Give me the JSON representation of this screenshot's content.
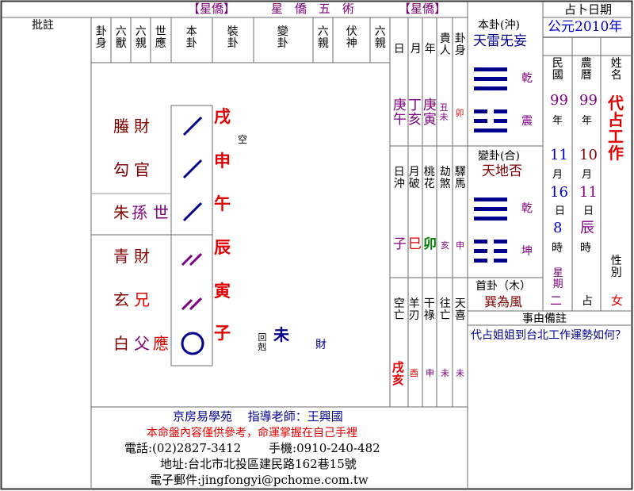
{
  "header": {
    "tag_left": "【星僑】",
    "title": "星　僑　五　術",
    "tag_right": "【星僑】",
    "pizhu": "批註"
  },
  "columns": {
    "guashen": "卦身",
    "liushou": "六獸",
    "liuqin": "六親",
    "shiying": "世應",
    "bengua": "本卦",
    "zhuanggua": "裝卦",
    "biangua": "變卦",
    "liuqin2": "六親",
    "fushen": "伏神",
    "liuqin3": "六親",
    "ri": "日",
    "yue": "月",
    "nian": "年",
    "guiren": "貴人",
    "guashen2": "卦身"
  },
  "lines": [
    {
      "beast": "螣",
      "relative": "財",
      "world": "",
      "yao": "yang",
      "branch": "戌",
      "note": "空"
    },
    {
      "beast": "勾",
      "relative": "官",
      "world": "",
      "yao": "yang",
      "branch": "申",
      "note": ""
    },
    {
      "beast": "朱",
      "relative": "孫",
      "world": "世",
      "yao": "yang",
      "branch": "午",
      "note": ""
    },
    {
      "beast": "青",
      "relative": "財",
      "world": "",
      "yao": "yin",
      "branch": "辰",
      "note": ""
    },
    {
      "beast": "玄",
      "relative": "兄",
      "world": "",
      "yao": "yin",
      "branch": "寅",
      "note": ""
    },
    {
      "beast": "白",
      "relative": "父",
      "world": "應",
      "yao": "moving",
      "branch": "子",
      "note": ""
    }
  ],
  "changed": {
    "mark": "回剋",
    "branch": "未",
    "relative": "財"
  },
  "dates": {
    "ri_gz": "庚午",
    "yue_gz": "丁亥",
    "nian_gz": "庚寅",
    "guiren": "丑未",
    "guashen": "卯",
    "richong_label": "日沖",
    "yuepo_label": "月破",
    "taohua_label": "桃花",
    "jiesha_label": "劫煞",
    "yima_label": "驛馬",
    "richong": "子",
    "yuepo": "巳",
    "taohua": "卯",
    "jiesha": "亥",
    "yima": "申",
    "kongwang_label": "空亡",
    "yangren_label": "羊刃",
    "ganlu_label": "干祿",
    "wangwang_label": "往亡",
    "tianxi_label": "天喜",
    "kongwang": "戌亥",
    "yangren": "酉",
    "ganlu": "申",
    "wangwang": "未",
    "tianxi": "未"
  },
  "hexagrams": {
    "ben_label": "本卦(沖)",
    "ben_name": "天雷旡妄",
    "ben_upper": "乾",
    "ben_lower": "震",
    "bian_label": "變卦(合)",
    "bian_name": "天地否",
    "bian_upper": "乾",
    "bian_lower": "坤",
    "shou_label": "首卦（木）",
    "shou_name": "巽為風"
  },
  "divination": {
    "title": "占卜日期",
    "era": "公元2010年",
    "minguo": "民國",
    "nongli": "農曆",
    "name_label": "姓名",
    "minguo_year": "99",
    "nongli_year": "99",
    "year_unit": "年",
    "minguo_month": "11",
    "nongli_month": "10",
    "month_unit": "月",
    "minguo_day": "16",
    "nongli_day": "11",
    "day_unit": "日",
    "minguo_hour": "8",
    "nongli_hour": "辰",
    "hour_unit": "時",
    "weekday_label": "星期",
    "weekday": "二",
    "zhan": "占",
    "name": "代占工作",
    "gender_label": "性別",
    "gender": "女"
  },
  "matter": {
    "title": "事由備註",
    "text": "代占姐姐到台北工作運勢如何？"
  },
  "footer": {
    "line1": "京房易學苑　 指導老師：王興國",
    "line2": "本命盤內容僅供參考，命運掌握在自己手裡",
    "line3": "電話:(02)2827-3412　　 手機:0910-240-482",
    "line4": "地址:台北市北投區建民路162巷15號",
    "line5": "電子郵件:jingfongyi@pchome.com.tw"
  }
}
